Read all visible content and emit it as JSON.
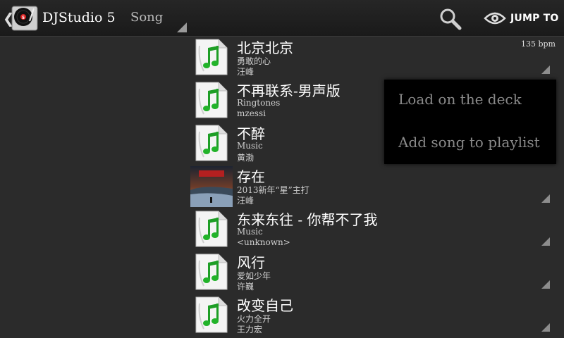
{
  "app": {
    "title": "DJStudio 5",
    "spinner_label": "Song",
    "jump_label": "JUMP TO"
  },
  "icons": {
    "back": "chevron-left-icon",
    "app": "turntable-icon",
    "search": "search-icon",
    "jump": "eye-icon",
    "track": "music-note-icon"
  },
  "colors": {
    "background": "#2b2b2b",
    "note_green": "#22b32a"
  },
  "tracks": [
    {
      "title": "北京北京",
      "album": "勇敢的心",
      "artist": "汪峰",
      "bpm": "135 bpm",
      "thumb": "music-note-icon"
    },
    {
      "title": "不再联系-男声版",
      "album": "Ringtones",
      "artist": "mzessi",
      "bpm": "",
      "thumb": "music-note-icon"
    },
    {
      "title": "不醉",
      "album": "Music",
      "artist": "黄渤",
      "bpm": "",
      "thumb": "music-note-icon"
    },
    {
      "title": "存在",
      "album": "2013新年“星”主打",
      "artist": "汪峰",
      "bpm": "",
      "thumb": "album-art"
    },
    {
      "title": "东来东往 - 你帮不了我",
      "album": "Music",
      "artist": "<unknown>",
      "bpm": "",
      "thumb": "music-note-icon"
    },
    {
      "title": "风行",
      "album": "爱如少年",
      "artist": "许巍",
      "bpm": "",
      "thumb": "music-note-icon"
    },
    {
      "title": "改变自己",
      "album": "火力全开",
      "artist": "王力宏",
      "bpm": "",
      "thumb": "music-note-icon"
    }
  ],
  "context_menu": {
    "items": [
      "Load on the deck",
      "Add song to playlist"
    ]
  }
}
